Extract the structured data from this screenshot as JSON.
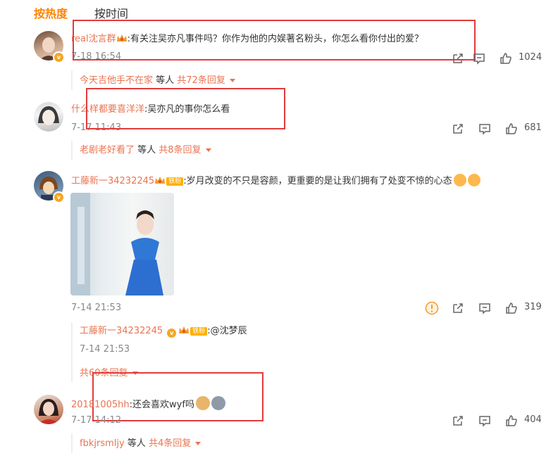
{
  "tabs": {
    "hot": "按热度",
    "time": "按时间"
  },
  "comments": [
    {
      "user": "real沈言群",
      "text": ":有关注吴亦凡事件吗？你作为他的内娱著名粉头，你怎么看你付出的爱？",
      "time": "7-18 16:54",
      "likes": "1024",
      "reply_summary": {
        "user": "今天吉他手不在家",
        "mid": " 等人 ",
        "count": "共72条回复"
      }
    },
    {
      "user": "什么样都要喜洋洋",
      "text": ":吴亦凡的事你怎么看",
      "time": "7-17 11:43",
      "likes": "681",
      "reply_summary": {
        "user": "老剧老好看了",
        "mid": " 等人 ",
        "count": "共8条回复"
      }
    },
    {
      "user": "工藤新一34232245",
      "badge": "铁粉",
      "text": ":岁月改变的不只是容颜，更重要的是让我们拥有了处变不惊的心态",
      "time": "7-14 21:53",
      "likes": "319",
      "reply": {
        "user": "工藤新一34232245",
        "badge": "铁粉",
        "text": ":@沈梦辰",
        "time": "7-14 21:53"
      },
      "reply_summary": {
        "count": "共60条回复"
      }
    },
    {
      "user": "20181005hh",
      "text": ":还会喜欢wyf吗",
      "time": "7-17 14:12",
      "likes": "404",
      "reply_summary": {
        "user": "fbkjrsmljy",
        "mid": " 等人 ",
        "count": "共4条回复"
      }
    }
  ],
  "colors": {
    "accent": "#ff8200",
    "username": "#eb7350",
    "highlight_box": "#e23b3b"
  }
}
